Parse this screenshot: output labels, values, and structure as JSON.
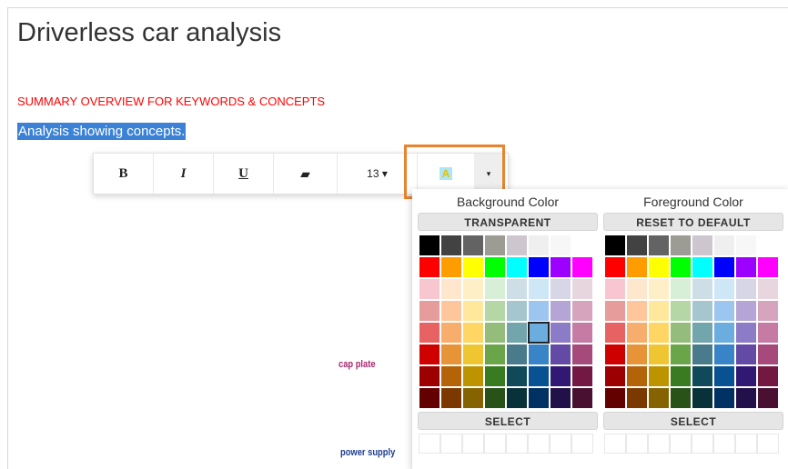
{
  "document": {
    "title": "Driverless car analysis",
    "summary": "SUMMARY OVERVIEW FOR KEYWORDS & CONCEPTS",
    "selected_text": "Analysis showing concepts."
  },
  "toolbar": {
    "bold": "B",
    "italic": "I",
    "underline": "U",
    "eraser": "▰",
    "font_size": "13 ▾",
    "color_icon": "A",
    "caret": "▾"
  },
  "color_picker": {
    "background": {
      "title": "Background Color",
      "transparent_label": "TRANSPARENT",
      "select_label": "SELECT",
      "selected_swatch": 37
    },
    "foreground": {
      "title": "Foreground Color",
      "reset_label": "RESET TO DEFAULT",
      "select_label": "SELECT"
    },
    "palette": [
      "#000000",
      "#424242",
      "#636363",
      "#9c9c94",
      "#cec6ce",
      "#efefef",
      "#f7f7f7",
      "#ffffff",
      "#ff0000",
      "#ff9c00",
      "#ffff00",
      "#00ff00",
      "#00ffff",
      "#0000ff",
      "#9c00ff",
      "#ff00ff",
      "#f7c6ce",
      "#ffe7ce",
      "#ffefc6",
      "#d6efd6",
      "#cedee7",
      "#cee7f7",
      "#d6d6e7",
      "#e7d6de",
      "#e79c9c",
      "#ffc69c",
      "#ffe79c",
      "#b5d6a5",
      "#a5c6ce",
      "#9cc6ef",
      "#b5a5d6",
      "#d6a5bd",
      "#e76363",
      "#f7ad6b",
      "#ffd663",
      "#94bd7b",
      "#73a5ad",
      "#6badde",
      "#8c7bc6",
      "#c67ba5",
      "#ce0000",
      "#e79439",
      "#efc631",
      "#6ba54a",
      "#4a7b8c",
      "#3984c6",
      "#634aa5",
      "#a54a7b",
      "#9c0000",
      "#b56308",
      "#bd9400",
      "#397b21",
      "#104a5a",
      "#085294",
      "#311873",
      "#731842",
      "#630000",
      "#7b3900",
      "#846300",
      "#295218",
      "#083139",
      "#003163",
      "#21104a",
      "#4a1031"
    ]
  },
  "labels": {
    "cap_plate": "cap plate",
    "power_supply": "power supply"
  }
}
